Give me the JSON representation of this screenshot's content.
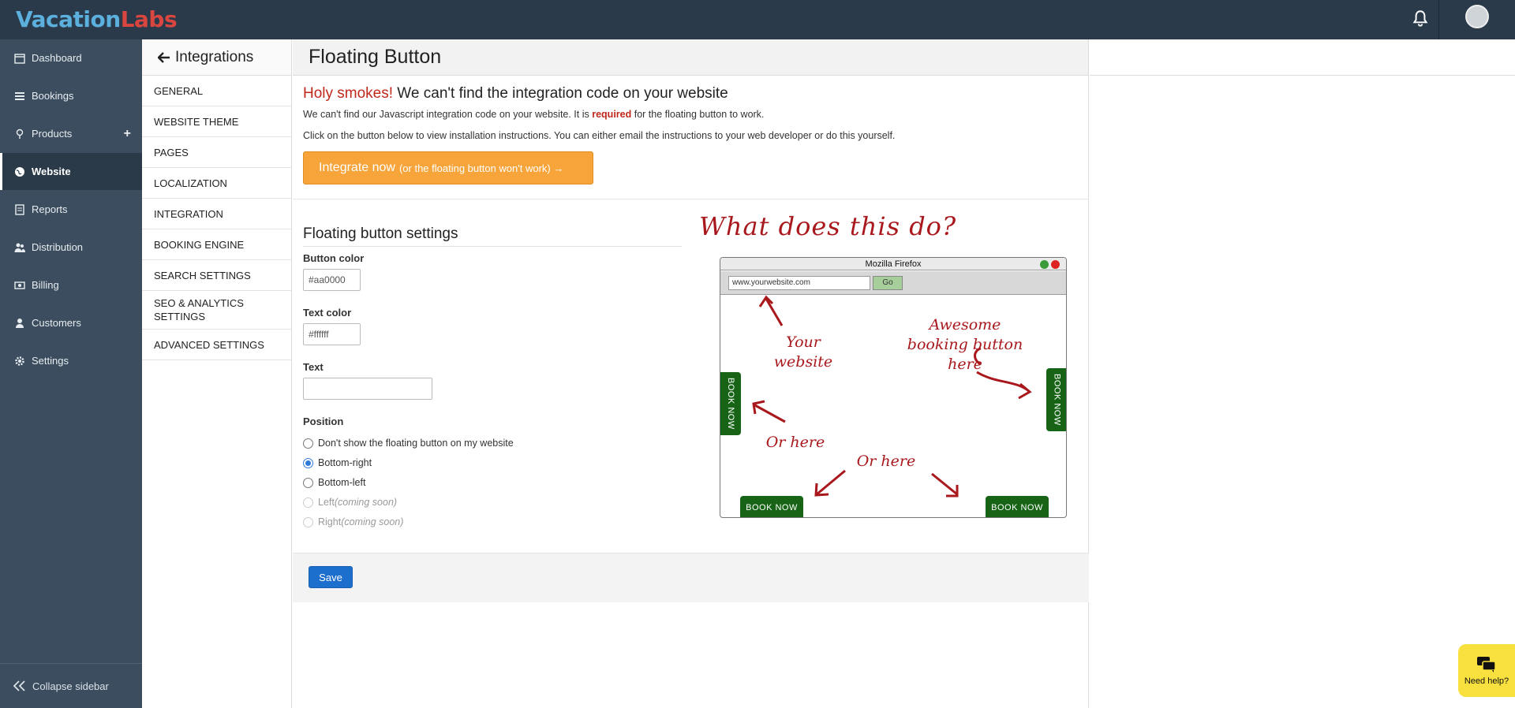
{
  "brand": {
    "part1": "Vacation",
    "part2": "Labs"
  },
  "sidebar": {
    "items": [
      {
        "label": "Dashboard",
        "icon": "calendar-icon"
      },
      {
        "label": "Bookings",
        "icon": "list-icon"
      },
      {
        "label": "Products",
        "icon": "pin-icon"
      },
      {
        "label": "Website",
        "icon": "globe-icon"
      },
      {
        "label": "Reports",
        "icon": "report-icon"
      },
      {
        "label": "Distribution",
        "icon": "users-icon"
      },
      {
        "label": "Billing",
        "icon": "money-icon"
      },
      {
        "label": "Customers",
        "icon": "user-icon"
      },
      {
        "label": "Settings",
        "icon": "gear-icon"
      }
    ],
    "products_plus": "+",
    "collapse_label": "Collapse sidebar"
  },
  "subnav": {
    "title": "Integrations",
    "items": [
      "GENERAL",
      "WEBSITE THEME",
      "PAGES",
      "LOCALIZATION",
      "INTEGRATION",
      "BOOKING ENGINE",
      "SEARCH SETTINGS",
      "SEO & ANALYTICS SETTINGS",
      "ADVANCED SETTINGS"
    ]
  },
  "main": {
    "title": "Floating Button",
    "alert": {
      "title_red": "Holy smokes!",
      "title_rest": " We can't find the integration code on your website",
      "line1_a": "We can't find our Javascript integration code on your website. It is ",
      "line1_b": "required",
      "line1_c": " for the floating button to work.",
      "line2": "Click on the button below to view installation instructions. You can either email the instructions to your web developer or do this yourself.",
      "button_main": "Integrate now",
      "button_sub": "(or the floating button won't work) →"
    },
    "settings": {
      "title": "Floating button settings",
      "button_color_label": "Button color",
      "button_color_value": "#aa0000",
      "text_color_label": "Text color",
      "text_color_value": "#ffffff",
      "text_label": "Text",
      "text_value": "",
      "position_label": "Position",
      "positions": [
        {
          "label": "Don't show the floating button on my website",
          "suffix": ""
        },
        {
          "label": "Bottom-right",
          "suffix": ""
        },
        {
          "label": "Bottom-left",
          "suffix": ""
        },
        {
          "label": "Left ",
          "suffix": "(coming soon)"
        },
        {
          "label": "Right ",
          "suffix": "(coming soon)"
        }
      ],
      "selected_position": "Bottom-right"
    },
    "save_label": "Save"
  },
  "illustration": {
    "heading": "What does this do?",
    "browser_title": "Mozilla Firefox",
    "url": "www.yourwebsite.com",
    "go": "Go",
    "note_website": "Your website",
    "note_awesome": "Awesome booking button here",
    "note_or_here_1": "Or here",
    "note_or_here_2": "Or here",
    "book_now": "BOOK NOW"
  },
  "help": {
    "label": "Need help?"
  },
  "colors": {
    "topbar": "#2a3a4b",
    "sidebar": "#3b4d5e",
    "accent_orange": "#f7a43a",
    "danger": "#c0281c",
    "book_green": "#176417"
  }
}
